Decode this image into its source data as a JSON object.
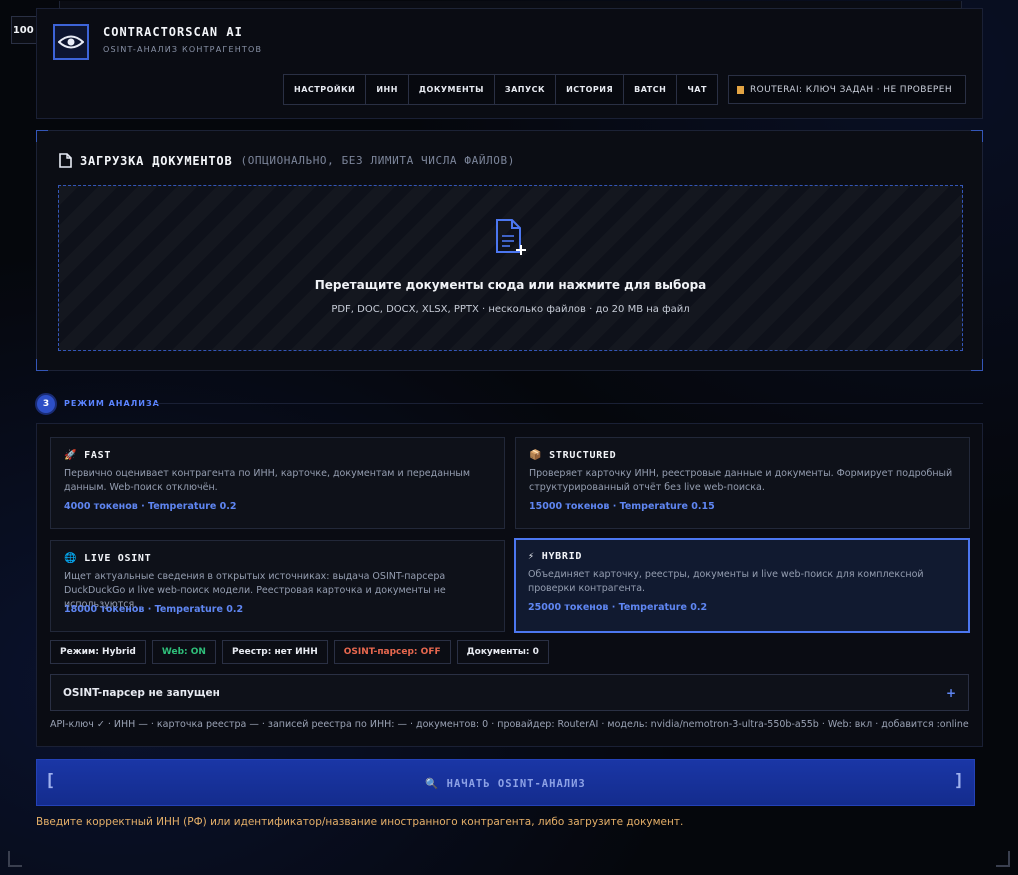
{
  "zoom": "100 %",
  "header": {
    "title": "CONTRACTORSCAN AI",
    "subtitle": "OSINT-АНАЛИЗ КОНТРАГЕНТОВ",
    "nav": [
      "НАСТРОЙКИ",
      "ИНН",
      "ДОКУМЕНТЫ",
      "ЗАПУСК",
      "ИСТОРИЯ",
      "BATCH",
      "ЧАТ"
    ],
    "router_status": "ROUTERAI: КЛЮЧ ЗАДАН · НЕ ПРОВЕРЕН"
  },
  "upload": {
    "title": "ЗАГРУЗКА ДОКУМЕНТОВ",
    "title_note": "(ОПЦИОНАЛЬНО, БЕЗ ЛИМИТА ЧИСЛА ФАЙЛОВ)",
    "drop_text": "Перетащите документы сюда или нажмите для выбора",
    "drop_hint": "PDF, DOC, DOCX, XLSX, PPTX · несколько файлов · до 20 MB на файл"
  },
  "section": {
    "number": "3",
    "label": "РЕЖИМ АНАЛИЗА"
  },
  "modes": [
    {
      "icon": "🚀",
      "title": "FAST",
      "desc": "Первично оценивает контрагента по ИНН, карточке, документам и переданным данным. Web-поиск отключён.",
      "meta": "4000 токенов · Temperature 0.2",
      "active": false
    },
    {
      "icon": "📦",
      "title": "STRUCTURED",
      "desc": "Проверяет карточку ИНН, реестровые данные и документы. Формирует подробный структурированный отчёт без live web-поиска.",
      "meta": "15000 токенов · Temperature 0.15",
      "active": false
    },
    {
      "icon": "🌐",
      "title": "LIVE OSINT",
      "desc": "Ищет актуальные сведения в открытых источниках: выдача OSINT-парсера DuckDuckGo и live web-поиск модели. Реестровая карточка и документы не используются.",
      "meta": "18000 токенов · Temperature 0.2",
      "active": false
    },
    {
      "icon": "⚡",
      "title": "HYBRID",
      "desc": "Объединяет карточку, реестры, документы и live web-поиск для комплексной проверки контрагента.",
      "meta": "25000 токенов · Temperature 0.2",
      "active": true
    }
  ],
  "chips": {
    "mode": "Режим: Hybrid",
    "web": "Web: ON",
    "registry": "Реестр: нет ИНН",
    "parser": "OSINT-парсер: OFF",
    "docs": "Документы: 0"
  },
  "colors": {
    "web_on": "#2fbf7a",
    "parser_off": "#e8684f",
    "accent": "#4c77f0",
    "warning": "#e6b069"
  },
  "parser_row": {
    "label": "OSINT-парсер не запущен",
    "toggle": "+"
  },
  "status_line": "API-ключ ✓ · ИНН — · карточка реестра — · записей реестра по ИНН: — · документов: 0 · провайдер: RouterAI · модель: nvidia/nemotron-3-ultra-550b-a55b · Web: вкл · добавится :online",
  "start": {
    "bracket_left": "[",
    "label": "🔍 НАЧАТЬ OSINT-АНАЛИЗ",
    "bracket_right": "]"
  },
  "warning": "Введите корректный ИНН (РФ) или идентификатор/название иностранного контрагента, либо загрузите документ."
}
